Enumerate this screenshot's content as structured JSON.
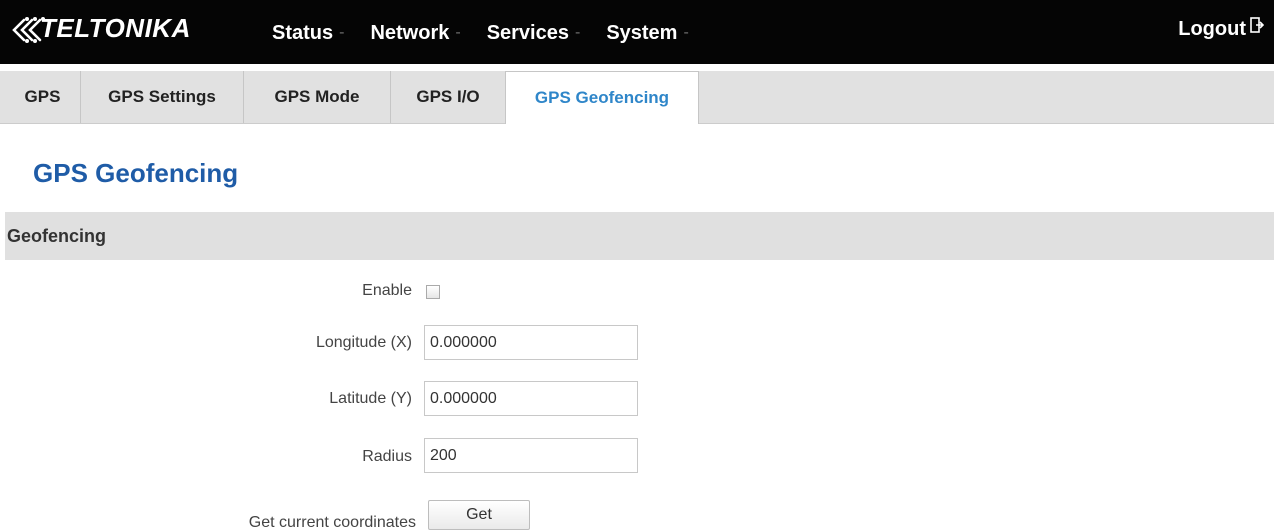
{
  "header": {
    "brand": "TELTONIKA",
    "nav": [
      {
        "label": "Status",
        "arrow": "-"
      },
      {
        "label": "Network",
        "arrow": "-"
      },
      {
        "label": "Services",
        "arrow": "-"
      },
      {
        "label": "System",
        "arrow": "-"
      }
    ],
    "logout_label": "Logout"
  },
  "tabs": [
    {
      "label": "GPS",
      "active": false
    },
    {
      "label": "GPS Settings",
      "active": false
    },
    {
      "label": "GPS Mode",
      "active": false
    },
    {
      "label": "GPS I/O",
      "active": false
    },
    {
      "label": "GPS Geofencing",
      "active": true
    }
  ],
  "page": {
    "title": "GPS Geofencing",
    "section_title": "Geofencing"
  },
  "form": {
    "enable": {
      "label": "Enable",
      "checked": false
    },
    "longitude": {
      "label": "Longitude (X)",
      "value": "0.000000"
    },
    "latitude": {
      "label": "Latitude (Y)",
      "value": "0.000000"
    },
    "radius": {
      "label": "Radius",
      "value": "200"
    },
    "get_coordinates": {
      "label": "Get current coordinates",
      "button_label": "Get"
    }
  },
  "colors": {
    "topbar": "#050505",
    "active_tab_text": "#2f86c9",
    "title": "#1f5ca7",
    "section_bg": "#e0e0e0"
  }
}
